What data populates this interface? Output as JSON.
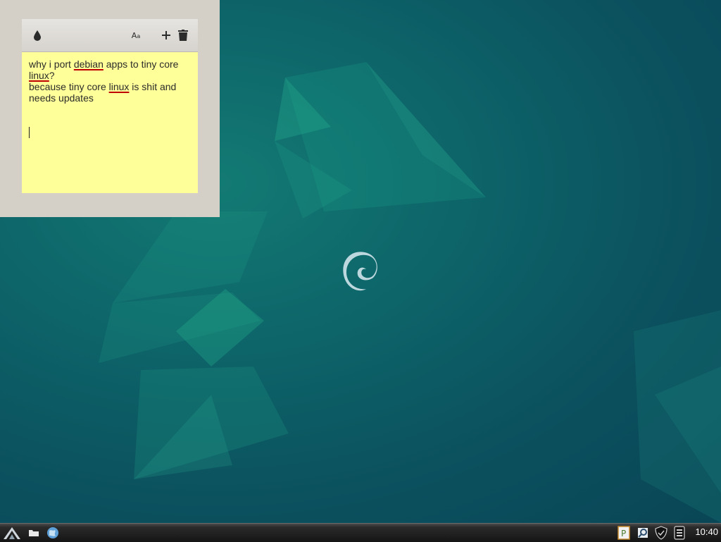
{
  "note": {
    "line1": "why i port ",
    "word1": "debian",
    "line1b": " apps to tiny core",
    "word2": "linux",
    "line2b": "?",
    "line3a": "because tiny core ",
    "word3": "linux",
    "line3b": " is shit and",
    "line4": "needs updates",
    "background_color": "#ffff99"
  },
  "toolbar": {
    "icons": [
      "color-drop-icon",
      "font-icon",
      "add-icon",
      "trash-icon"
    ]
  },
  "taskbar": {
    "clock": "10:40"
  }
}
